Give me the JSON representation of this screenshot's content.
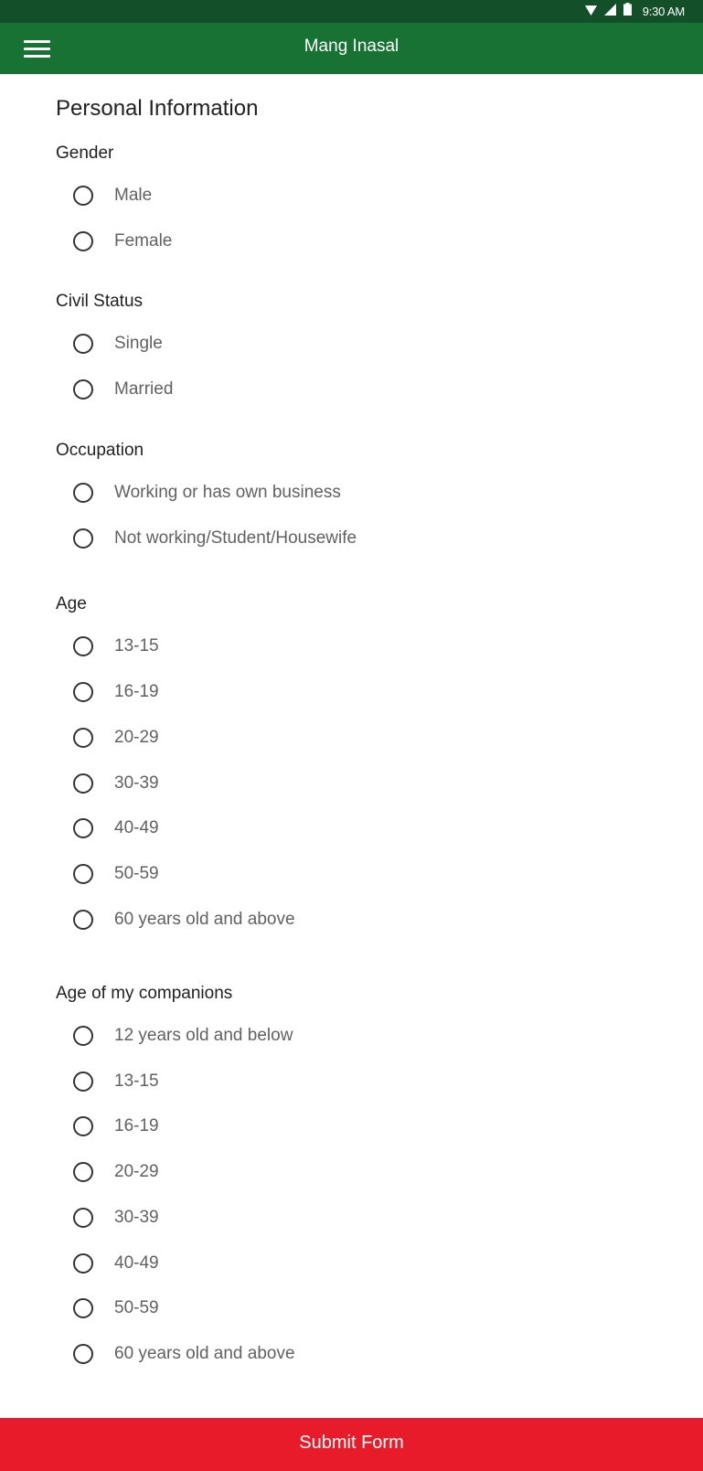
{
  "status_bar": {
    "time": "9:30 AM",
    "icons": [
      "wifi-icon",
      "cell-signal-icon",
      "battery-icon"
    ]
  },
  "app_bar": {
    "title": "Mang Inasal",
    "menu_icon": "hamburger-menu-icon"
  },
  "form": {
    "title": "Personal Information",
    "gender": {
      "label": "Gender",
      "options": [
        "Male",
        "Female"
      ]
    },
    "civil_status": {
      "label": "Civil Status",
      "options": [
        "Single",
        "Married"
      ]
    },
    "occupation": {
      "label": "Occupation",
      "options": [
        "Working or has own business",
        "Not working/Student/Housewife"
      ]
    },
    "age": {
      "label": "Age",
      "options": [
        "13-15",
        "16-19",
        "20-29",
        "30-39",
        "40-49",
        "50-59",
        "60 years old and above"
      ]
    },
    "companions_age": {
      "label": "Age of my companions",
      "options": [
        "12 years old and below",
        "13-15",
        "16-19",
        "20-29",
        "30-39",
        "40-49",
        "50-59",
        "60 years old and above"
      ]
    }
  },
  "submit": {
    "label": "Submit Form"
  },
  "colors": {
    "status_bar": "#13502a",
    "app_bar": "#177234",
    "submit": "#e81b2a"
  }
}
